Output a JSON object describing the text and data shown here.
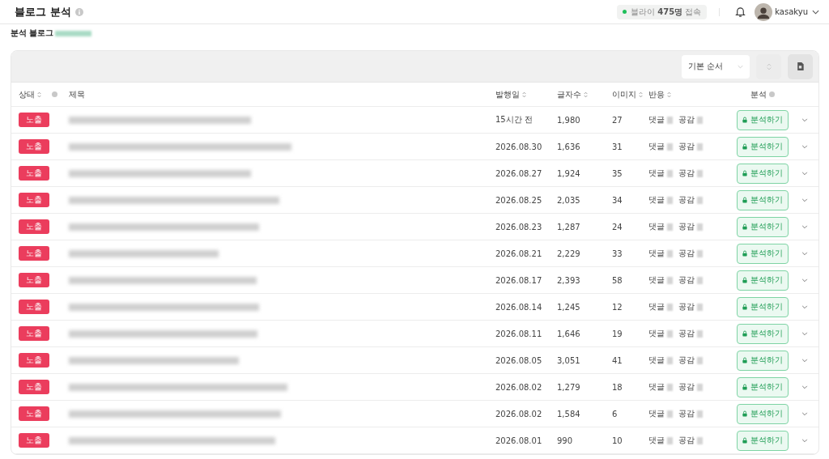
{
  "header": {
    "title": "블로그 분석",
    "online": {
      "label": "블라이",
      "count": "475명",
      "suffix": "접속"
    },
    "user": "kasakyu"
  },
  "section_title": "분석 블로그",
  "toolbar": {
    "sort": "기본 순서"
  },
  "table": {
    "columns": [
      {
        "label": "상태",
        "kind": "sort"
      },
      {
        "label": "제목",
        "kind": "plain"
      },
      {
        "label": "발행일",
        "kind": "sort"
      },
      {
        "label": "글자수",
        "kind": "sort"
      },
      {
        "label": "이미지",
        "kind": "sort"
      },
      {
        "label": "반응",
        "kind": "sort"
      },
      {
        "label": "분석",
        "kind": "info"
      }
    ],
    "rows": [
      {
        "status": "노출",
        "date": "15시간 전",
        "chars": "1,980",
        "images": "27",
        "comments": "댓글",
        "likes": "공감",
        "action": "분석하기"
      },
      {
        "status": "노출",
        "date": "2026.08.30",
        "chars": "1,636",
        "images": "31",
        "comments": "댓글",
        "likes": "공감",
        "action": "분석하기"
      },
      {
        "status": "노출",
        "date": "2026.08.27",
        "chars": "1,924",
        "images": "35",
        "comments": "댓글",
        "likes": "공감",
        "action": "분석하기"
      },
      {
        "status": "노출",
        "date": "2026.08.25",
        "chars": "2,035",
        "images": "34",
        "comments": "댓글",
        "likes": "공감",
        "action": "분석하기"
      },
      {
        "status": "노출",
        "date": "2026.08.23",
        "chars": "1,287",
        "images": "24",
        "comments": "댓글",
        "likes": "공감",
        "action": "분석하기"
      },
      {
        "status": "노출",
        "date": "2026.08.21",
        "chars": "2,229",
        "images": "33",
        "comments": "댓글",
        "likes": "공감",
        "action": "분석하기"
      },
      {
        "status": "노출",
        "date": "2026.08.17",
        "chars": "2,393",
        "images": "58",
        "comments": "댓글",
        "likes": "공감",
        "action": "분석하기"
      },
      {
        "status": "노출",
        "date": "2026.08.14",
        "chars": "1,245",
        "images": "12",
        "comments": "댓글",
        "likes": "공감",
        "action": "분석하기"
      },
      {
        "status": "노출",
        "date": "2026.08.11",
        "chars": "1,646",
        "images": "19",
        "comments": "댓글",
        "likes": "공감",
        "action": "분석하기"
      },
      {
        "status": "노출",
        "date": "2026.08.05",
        "chars": "3,051",
        "images": "41",
        "comments": "댓글",
        "likes": "공감",
        "action": "분석하기"
      },
      {
        "status": "노출",
        "date": "2026.08.02",
        "chars": "1,279",
        "images": "18",
        "comments": "댓글",
        "likes": "공감",
        "action": "분석하기"
      },
      {
        "status": "노출",
        "date": "2026.08.02",
        "chars": "1,584",
        "images": "6",
        "comments": "댓글",
        "likes": "공감",
        "action": "분석하기"
      },
      {
        "status": "노출",
        "date": "2026.08.01",
        "chars": "990",
        "images": "10",
        "comments": "댓글",
        "likes": "공감",
        "action": "분석하기"
      }
    ]
  }
}
